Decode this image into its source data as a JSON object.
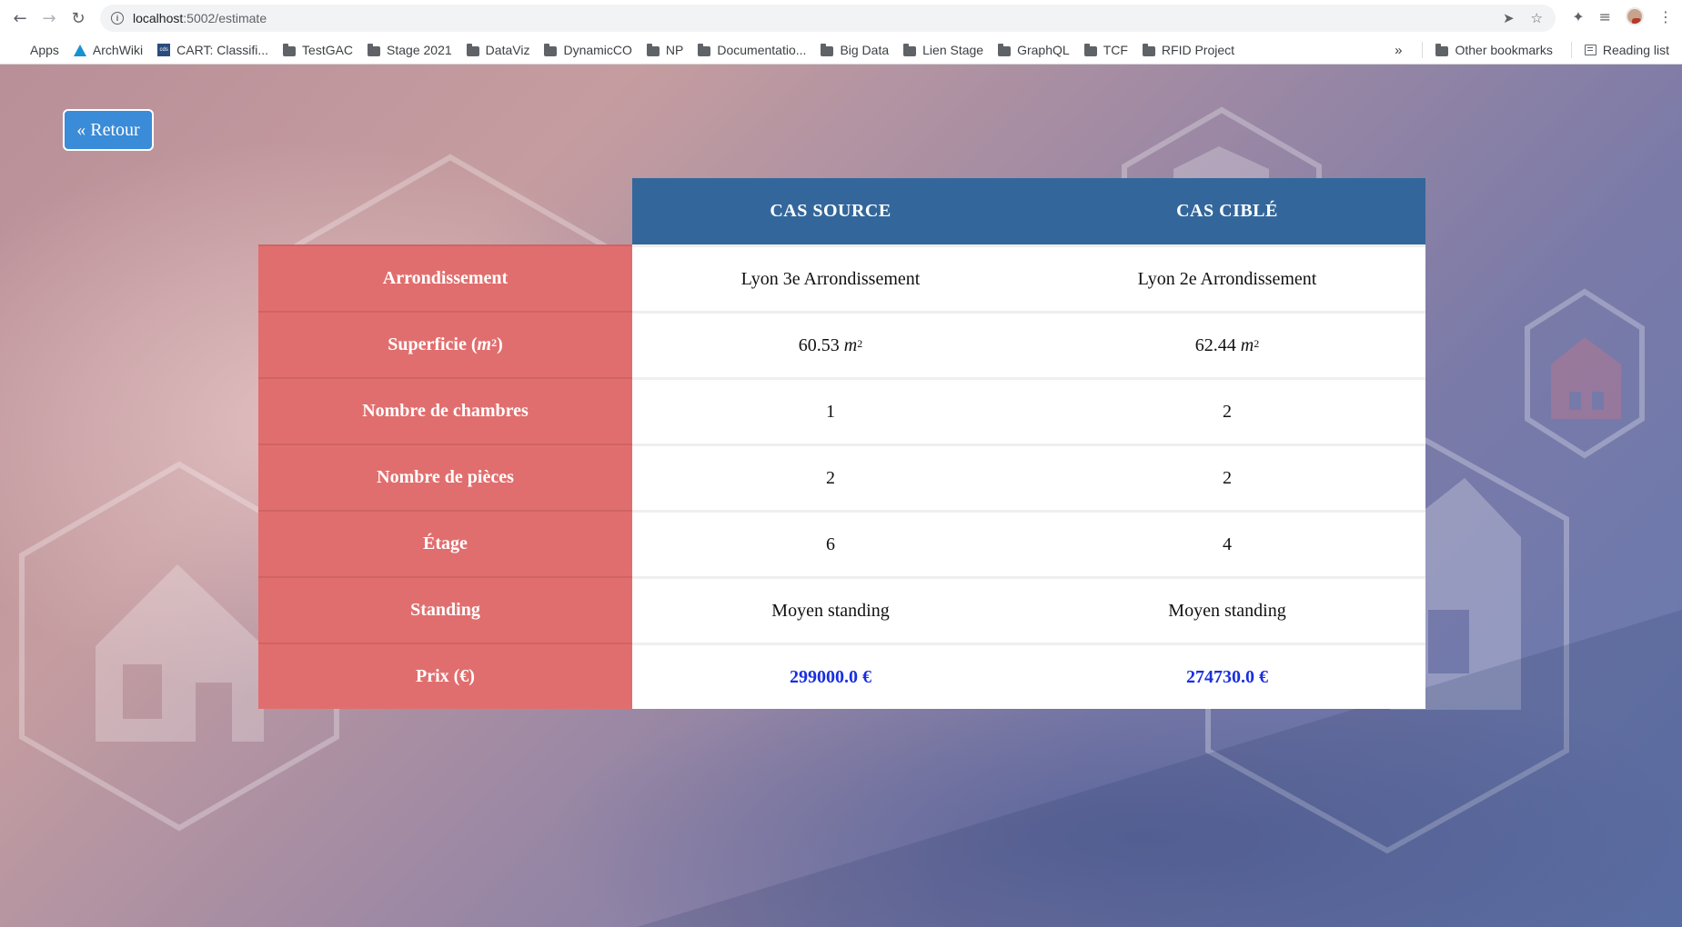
{
  "browser": {
    "url_host": "localhost",
    "url_rest": ":5002/estimate",
    "bookmarks": [
      {
        "label": "Apps",
        "icon": "apps-grid-icon"
      },
      {
        "label": "ArchWiki",
        "icon": "archlinux-icon"
      },
      {
        "label": "CART: Classifi...",
        "icon": "cart-favicon"
      },
      {
        "label": "TestGAC",
        "icon": "folder-icon"
      },
      {
        "label": "Stage 2021",
        "icon": "folder-icon"
      },
      {
        "label": "DataViz",
        "icon": "folder-icon"
      },
      {
        "label": "DynamicCO",
        "icon": "folder-icon"
      },
      {
        "label": "NP",
        "icon": "folder-icon"
      },
      {
        "label": "Documentatio...",
        "icon": "folder-icon"
      },
      {
        "label": "Big Data",
        "icon": "folder-icon"
      },
      {
        "label": "Lien Stage",
        "icon": "folder-icon"
      },
      {
        "label": "GraphQL",
        "icon": "folder-icon"
      },
      {
        "label": "TCF",
        "icon": "folder-icon"
      },
      {
        "label": "RFID Project",
        "icon": "folder-icon"
      }
    ],
    "overflow_label": "»",
    "other_bookmarks": "Other bookmarks",
    "reading_list": "Reading list"
  },
  "page": {
    "back_button": "« Retour",
    "columns": [
      "CAS SOURCE",
      "CAS CIBLÉ"
    ],
    "rows": [
      {
        "label": "Arrondissement",
        "source": "Lyon 3e Arrondissement",
        "target": "Lyon 2e Arrondissement"
      },
      {
        "label": "Superficie (m2)",
        "source": "60.53",
        "target": "62.44"
      },
      {
        "label": "Nombre de chambres",
        "source": "1",
        "target": "2"
      },
      {
        "label": "Nombre de pièces",
        "source": "2",
        "target": "2"
      },
      {
        "label": "Étage",
        "source": "6",
        "target": "4"
      },
      {
        "label": "Standing",
        "source": "Moyen standing",
        "target": "Moyen standing"
      },
      {
        "label": "Prix (€)",
        "source": "299000.0 €",
        "target": "274730.0 €"
      }
    ],
    "area_unit": "m",
    "area_exponent": "2",
    "superficie_label_prefix": "Superficie (",
    "superficie_label_suffix": ")"
  },
  "colors": {
    "header_blue": "#33679b",
    "label_red": "#e16e6e",
    "price_blue": "#1a2fe0",
    "button_blue": "#3a8bd8"
  }
}
